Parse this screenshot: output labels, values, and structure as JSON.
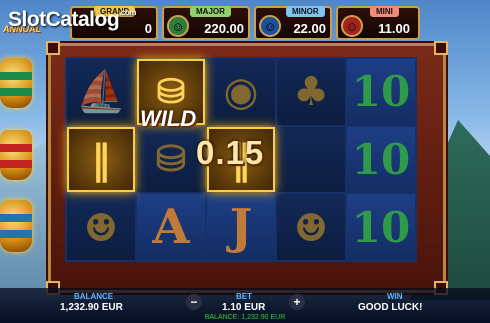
{
  "watermark": "SlotCatalog",
  "watermark_suffix": ".com",
  "game_title": "ANNUAL",
  "jackpots": {
    "grand": {
      "label": "GRAND",
      "value": "0"
    },
    "major": {
      "label": "MAJOR",
      "value": "220.00"
    },
    "minor": {
      "label": "MINOR",
      "value": "22.00"
    },
    "mini": {
      "label": "MINI",
      "value": "11.00"
    }
  },
  "reels": [
    [
      "junk",
      "wild",
      "coin",
      "tree",
      "10"
    ],
    [
      "bamboo",
      "gold-ingot",
      "bamboo",
      "",
      "10"
    ],
    [
      "cat",
      "A",
      "J",
      "cat",
      "10"
    ]
  ],
  "win_overlay": {
    "wild_text": "WILD",
    "amount": "0.15"
  },
  "bottom": {
    "balance_label": "BALANCE",
    "balance_value": "1,232.90 EUR",
    "bet_label": "BET",
    "bet_value": "1.10 EUR",
    "minus": "−",
    "plus": "+",
    "win_label": "WIN",
    "win_value": "GOOD LUCK!",
    "footer": "BALANCE: 1,232.90 EUR"
  },
  "colors": {
    "accent": "#caa04a",
    "label_blue": "#5fb4ff",
    "frame": "#7a2a18",
    "reel_bg": "#17306a"
  }
}
